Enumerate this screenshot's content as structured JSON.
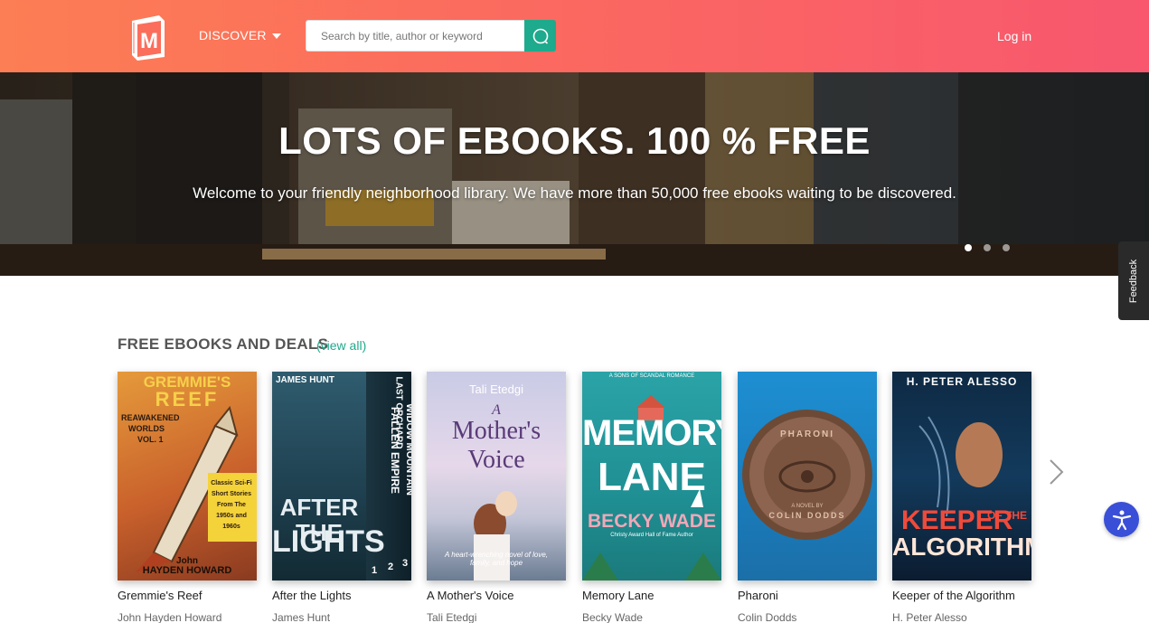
{
  "header": {
    "logo_letter": "M",
    "discover_label": "DISCOVER",
    "search_placeholder": "Search by title, author or keyword",
    "login_label": "Log in"
  },
  "hero": {
    "title": "LOTS OF EBOOKS. 100 % FREE",
    "subtitle": "Welcome to your friendly neighborhood library. We have more than 50,000 free ebooks waiting to be discovered.",
    "slides": 3,
    "active_slide": 1
  },
  "feedback_label": "Feedback",
  "section": {
    "title": "FREE EBOOKS AND DEALS",
    "view_all": "(view all)"
  },
  "books": [
    {
      "title": "Gremmie's Reef",
      "author": "John Hayden Howard",
      "cover_text": [
        "GREMMIE'S",
        "REEF",
        "REAWAKENED",
        "WORLDS",
        "VOL. 1",
        "Classic Sci-Fi Short Stories From The 1950s and 1960s",
        "John",
        "HAYDEN HOWARD"
      ]
    },
    {
      "title": "After the Lights",
      "author": "James Hunt",
      "cover_text": [
        "JAMES HUNT",
        "AFTER THE",
        "LIGHTS",
        "FALLEN EMPIRE",
        "WIDOW MOUNTAIN",
        "LAST ORCHARD",
        "1",
        "2",
        "3"
      ]
    },
    {
      "title": "A Mother's Voice",
      "author": "Tali Etedgi",
      "cover_text": [
        "Tali Etedgi",
        "A",
        "Mother's",
        "Voice",
        "A heart-wrenching novel of love, family, and hope"
      ]
    },
    {
      "title": "Memory Lane",
      "author": "Becky Wade",
      "cover_text": [
        "A SONS OF SCANDAL ROMANCE",
        "MEMORY",
        "LANE",
        "BECKY WADE",
        "Christy Award Hall of Fame Author"
      ]
    },
    {
      "title": "Pharoni",
      "author": "Colin Dodds",
      "cover_text": [
        "PHARONI",
        "A NOVEL BY",
        "COLIN DODDS"
      ]
    },
    {
      "title": "Keeper of the Algorithm",
      "author": "H. Peter Alesso",
      "cover_text": [
        "H. PETER ALESSO",
        "KEEPER",
        "OF THE",
        "ALGORITHM"
      ]
    }
  ],
  "colors": {
    "header_start": "#fc7e54",
    "header_end": "#f8576e",
    "accent": "#1eaa8c",
    "accessibility": "#3a4fd8"
  },
  "icons": {
    "search": "search-icon",
    "next": "chevron-right-icon",
    "accessibility": "accessibility-icon",
    "caret": "caret-down-icon"
  }
}
